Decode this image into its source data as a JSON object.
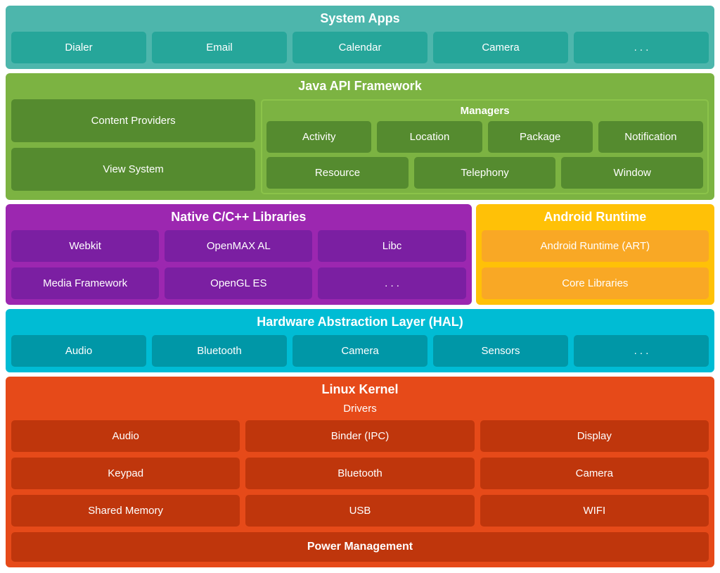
{
  "system_apps": {
    "title": "System Apps",
    "items": [
      "Dialer",
      "Email",
      "Calendar",
      "Camera",
      ". . ."
    ]
  },
  "java_api": {
    "title": "Java API Framework",
    "content_providers_label": "Content Providers",
    "view_system_label": "View System",
    "managers_label": "Managers",
    "managers_row1": [
      "Activity",
      "Location",
      "Package",
      "Notification"
    ],
    "managers_row2": [
      "Resource",
      "Telephony",
      "Window"
    ]
  },
  "native": {
    "title": "Native C/C++ Libraries",
    "row1": [
      "Webkit",
      "OpenMAX AL",
      "Libc"
    ],
    "row2": [
      "Media Framework",
      "OpenGL ES",
      ". . ."
    ]
  },
  "android_runtime": {
    "title": "Android Runtime",
    "items": [
      "Android Runtime (ART)",
      "Core Libraries"
    ]
  },
  "hal": {
    "title": "Hardware Abstraction Layer (HAL)",
    "items": [
      "Audio",
      "Bluetooth",
      "Camera",
      "Sensors",
      ". . ."
    ]
  },
  "linux": {
    "title": "Linux Kernel",
    "drivers_label": "Drivers",
    "row1": [
      "Audio",
      "Binder (IPC)",
      "Display"
    ],
    "row2": [
      "Keypad",
      "Bluetooth",
      "Camera"
    ],
    "row3": [
      "Shared Memory",
      "USB",
      "WIFI"
    ],
    "power_management": "Power Management"
  }
}
